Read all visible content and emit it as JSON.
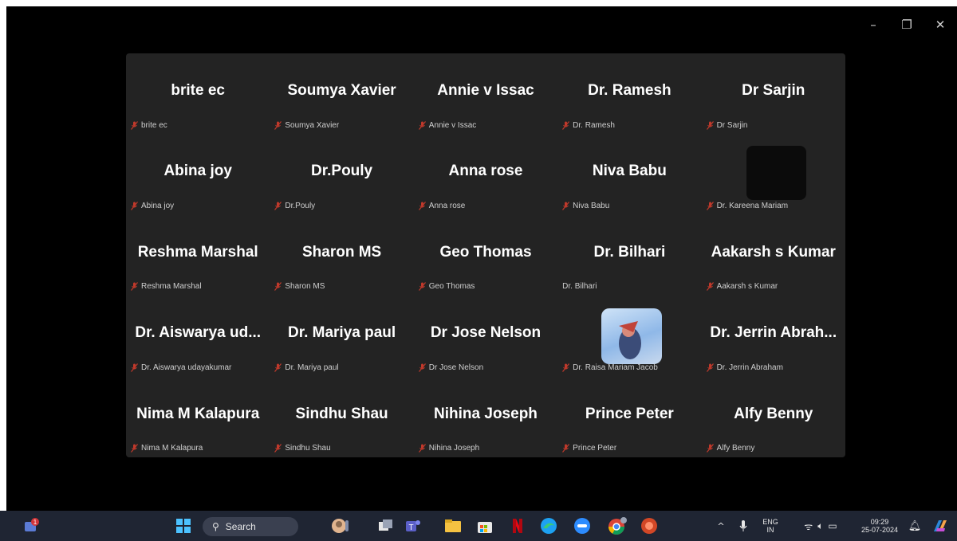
{
  "window_controls": {
    "minimize": "–",
    "restore": "❐",
    "close": "✕"
  },
  "participants": [
    {
      "name": "brite ec",
      "label": "brite ec",
      "muted": true
    },
    {
      "name": "Soumya Xavier",
      "label": "Soumya Xavier",
      "muted": true
    },
    {
      "name": "Annie v Issac",
      "label": "Annie v Issac",
      "muted": true
    },
    {
      "name": "Dr. Ramesh",
      "label": "Dr. Ramesh",
      "muted": true
    },
    {
      "name": "Dr Sarjin",
      "label": "Dr Sarjin",
      "muted": true
    },
    {
      "name": "Abina joy",
      "label": "Abina joy",
      "muted": true
    },
    {
      "name": "Dr.Pouly",
      "label": "Dr.Pouly",
      "muted": true
    },
    {
      "name": "Anna rose",
      "label": "Anna rose",
      "muted": true
    },
    {
      "name": "Niva Babu",
      "label": "Niva Babu",
      "muted": true
    },
    {
      "name": "",
      "label": "Dr. Kareena Mariam",
      "muted": true,
      "video": "dark"
    },
    {
      "name": "Reshma Marshal",
      "label": "Reshma Marshal",
      "muted": true
    },
    {
      "name": "Sharon MS",
      "label": "Sharon MS",
      "muted": true
    },
    {
      "name": "Geo  Thomas",
      "label": "Geo  Thomas",
      "muted": true
    },
    {
      "name": "Dr. Bilhari",
      "label": "Dr. Bilhari",
      "muted": false
    },
    {
      "name": "Aakarsh s Kumar",
      "label": "Aakarsh s Kumar",
      "muted": true
    },
    {
      "name": "Dr. Aiswarya ud...",
      "label": "Dr. Aiswarya udayakumar",
      "muted": true
    },
    {
      "name": "Dr. Mariya paul",
      "label": "Dr. Mariya paul",
      "muted": true
    },
    {
      "name": "Dr Jose Nelson",
      "label": "Dr Jose Nelson",
      "muted": true
    },
    {
      "name": "",
      "label": "Dr. Raisa Mariam Jacob",
      "muted": true,
      "video": "avatar"
    },
    {
      "name": "Dr. Jerrin  Abrah...",
      "label": "Dr. Jerrin Abraham",
      "muted": true
    },
    {
      "name": "Nima M Kalapura",
      "label": "Nima M Kalapura",
      "muted": true
    },
    {
      "name": "Sindhu Shau",
      "label": "Sindhu Shau",
      "muted": true
    },
    {
      "name": "Nihina Joseph",
      "label": "Nihina Joseph",
      "muted": true
    },
    {
      "name": "Prince Peter",
      "label": "Prince Peter",
      "muted": true
    },
    {
      "name": "Alfy Benny",
      "label": "Alfy Benny",
      "muted": true
    }
  ],
  "taskbar": {
    "search_label": "Search",
    "notification_count": "1",
    "lang_top": "ENG",
    "lang_bottom": "IN",
    "time": "09:29",
    "date": "25-07-2024"
  },
  "colors": {
    "muted_mic": "#c0392b",
    "panel": "#232323",
    "taskbar": "#1f2533"
  }
}
